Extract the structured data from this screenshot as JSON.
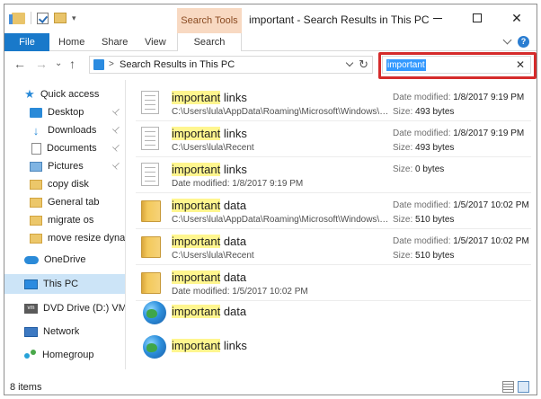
{
  "titlebar": {
    "context_tab": "Search Tools",
    "title": "important - Search Results in This PC",
    "min_icon": "minimize-icon",
    "max_icon": "maximize-icon",
    "close_glyph": "✕"
  },
  "ribbon": {
    "tabs": [
      "File",
      "Home",
      "Share",
      "View",
      "Search"
    ],
    "help_glyph": "?"
  },
  "address": {
    "back_glyph": "←",
    "forward_glyph": "→",
    "recent_glyph": "⌄",
    "up_glyph": "↑",
    "separator": ">",
    "path": "Search Results in This PC",
    "refresh_glyph": "↻"
  },
  "search": {
    "value": "important",
    "clear_glyph": "✕"
  },
  "nav": {
    "pin_glyph": "📌",
    "items": [
      {
        "label": "Quick access",
        "icon": "star-icon"
      },
      {
        "label": "Desktop",
        "icon": "desktop-icon"
      },
      {
        "label": "Downloads",
        "icon": "download-icon"
      },
      {
        "label": "Documents",
        "icon": "documents-icon"
      },
      {
        "label": "Pictures",
        "icon": "pictures-icon"
      },
      {
        "label": "copy disk",
        "icon": "folder-icon"
      },
      {
        "label": "General tab",
        "icon": "folder-icon"
      },
      {
        "label": "migrate os",
        "icon": "folder-icon"
      },
      {
        "label": "move resize dynam",
        "icon": "folder-icon"
      },
      {
        "label": "OneDrive",
        "icon": "onedrive-icon"
      },
      {
        "label": "This PC",
        "icon": "this-pc-icon"
      },
      {
        "label": "DVD Drive (D:) VMwa",
        "icon": "dvd-drive-icon"
      },
      {
        "label": "Network",
        "icon": "network-icon"
      },
      {
        "label": "Homegroup",
        "icon": "homegroup-icon"
      }
    ],
    "vm_badge": "vm"
  },
  "results": [
    {
      "match": "important",
      "rest": " links",
      "sub": "C:\\Users\\lula\\AppData\\Roaming\\Microsoft\\Windows\\Recent",
      "meta1_label": "Date modified: ",
      "meta1_value": "1/8/2017 9:19 PM",
      "meta2_label": "Size: ",
      "meta2_value": "493 bytes",
      "icon": "shortcut-file-icon"
    },
    {
      "match": "important",
      "rest": " links",
      "sub": "C:\\Users\\lula\\Recent",
      "meta1_label": "Date modified: ",
      "meta1_value": "1/8/2017 9:19 PM",
      "meta2_label": "Size: ",
      "meta2_value": "493 bytes",
      "icon": "shortcut-file-icon"
    },
    {
      "match": "important",
      "rest": " links",
      "sub": "Date modified: 1/8/2017 9:19 PM",
      "meta1_label": "Size: ",
      "meta1_value": "0 bytes",
      "meta2_label": "",
      "meta2_value": "",
      "icon": "file-icon"
    },
    {
      "match": "important",
      "rest": " data",
      "sub": "C:\\Users\\lula\\AppData\\Roaming\\Microsoft\\Windows\\Recent",
      "meta1_label": "Date modified: ",
      "meta1_value": "1/5/2017 10:02 PM",
      "meta2_label": "Size: ",
      "meta2_value": "510 bytes",
      "icon": "folder-shortcut-icon"
    },
    {
      "match": "important",
      "rest": " data",
      "sub": "C:\\Users\\lula\\Recent",
      "meta1_label": "Date modified: ",
      "meta1_value": "1/5/2017 10:02 PM",
      "meta2_label": "Size: ",
      "meta2_value": "510 bytes",
      "icon": "folder-shortcut-icon"
    },
    {
      "match": "important",
      "rest": " data",
      "sub": "Date modified: 1/5/2017 10:02 PM",
      "meta1_label": "",
      "meta1_value": "",
      "meta2_label": "",
      "meta2_value": "",
      "icon": "folder-icon"
    },
    {
      "match": "important",
      "rest": " data",
      "sub": "",
      "meta1_label": "",
      "meta1_value": "",
      "meta2_label": "",
      "meta2_value": "",
      "icon": "globe-icon"
    },
    {
      "match": "important",
      "rest": " links",
      "sub": "",
      "meta1_label": "",
      "meta1_value": "",
      "meta2_label": "",
      "meta2_value": "",
      "icon": "globe-icon"
    }
  ],
  "status": {
    "count": "8 items"
  },
  "colors": {
    "accent": "#1979ca",
    "context_tab": "#f8d9c2",
    "highlight": "#fff68f",
    "selection": "#cce4f7",
    "callout": "#d52b2b"
  }
}
